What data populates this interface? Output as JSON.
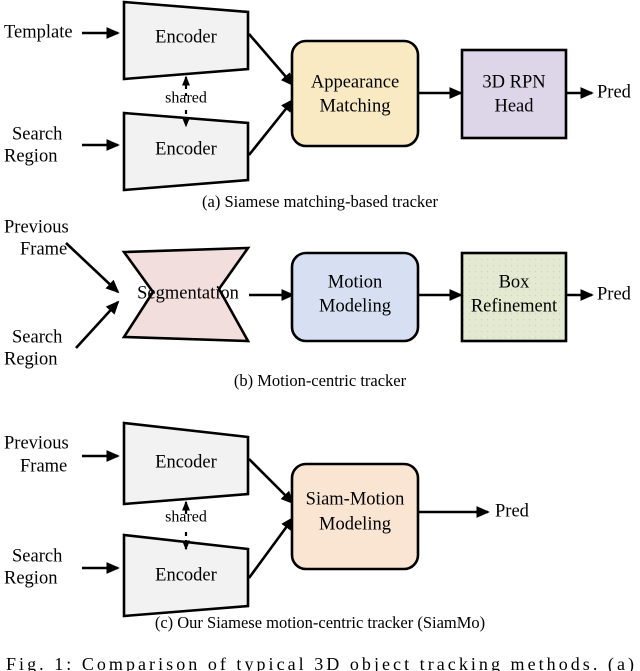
{
  "figure": {
    "caption": "Fig. 1: Comparison of typical 3D object tracking methods. (a)",
    "panels": [
      {
        "id": "a",
        "subcaption": "(a) Siamese matching-based tracker",
        "inputs": [
          "Template",
          "Search Region"
        ],
        "blocks": [
          "Encoder",
          "Encoder",
          "Appearance Matching",
          "3D RPN Head"
        ],
        "link_label": "shared",
        "output": "Pred"
      },
      {
        "id": "b",
        "subcaption": "(b) Motion-centric tracker",
        "inputs": [
          "Previous Frame",
          "Search Region"
        ],
        "blocks": [
          "Segmentation",
          "Motion Modeling",
          "Box Refinement"
        ],
        "output": "Pred"
      },
      {
        "id": "c",
        "subcaption": "(c) Our Siamese motion-centric tracker (SiamMo)",
        "inputs": [
          "Previous Frame",
          "Search Region"
        ],
        "blocks": [
          "Encoder",
          "Encoder",
          "Siam-Motion Modeling"
        ],
        "link_label": "shared",
        "output": "Pred"
      }
    ]
  },
  "labels": {
    "template": "Template",
    "search": "Search",
    "region": "Region",
    "previous": "Previous",
    "frame": "Frame",
    "encoder": "Encoder",
    "shared": "shared",
    "appearance": "Appearance",
    "matching": "Matching",
    "rpn_line1": "3D RPN",
    "rpn_line2": "Head",
    "segmentation": "Segmentation",
    "motion": "Motion",
    "modeling": "Modeling",
    "box": "Box",
    "refinement": "Refinement",
    "siam_motion": "Siam-Motion",
    "siam_modeling": "Modeling",
    "pred": "Pred"
  },
  "subcaptions": {
    "a": "(a) Siamese matching-based tracker",
    "b": "(b) Motion-centric tracker",
    "c": "(c) Our Siamese motion-centric tracker (SiamMo)"
  },
  "main_caption": "Fig. 1: Comparison of typical 3D object tracking methods. (a)",
  "colors": {
    "encoder_fill": "#f2f2f2",
    "appearance_matching_fill": "#faeac4",
    "rpn_head_fill": "#dcd6e8",
    "segmentation_fill": "#f2dedc",
    "motion_modeling_fill": "#d7e0f2",
    "box_refinement_fill": "#e4ead2",
    "siam_motion_fill": "#fae4d2",
    "stroke": "#000000",
    "background": "#ffffff"
  }
}
